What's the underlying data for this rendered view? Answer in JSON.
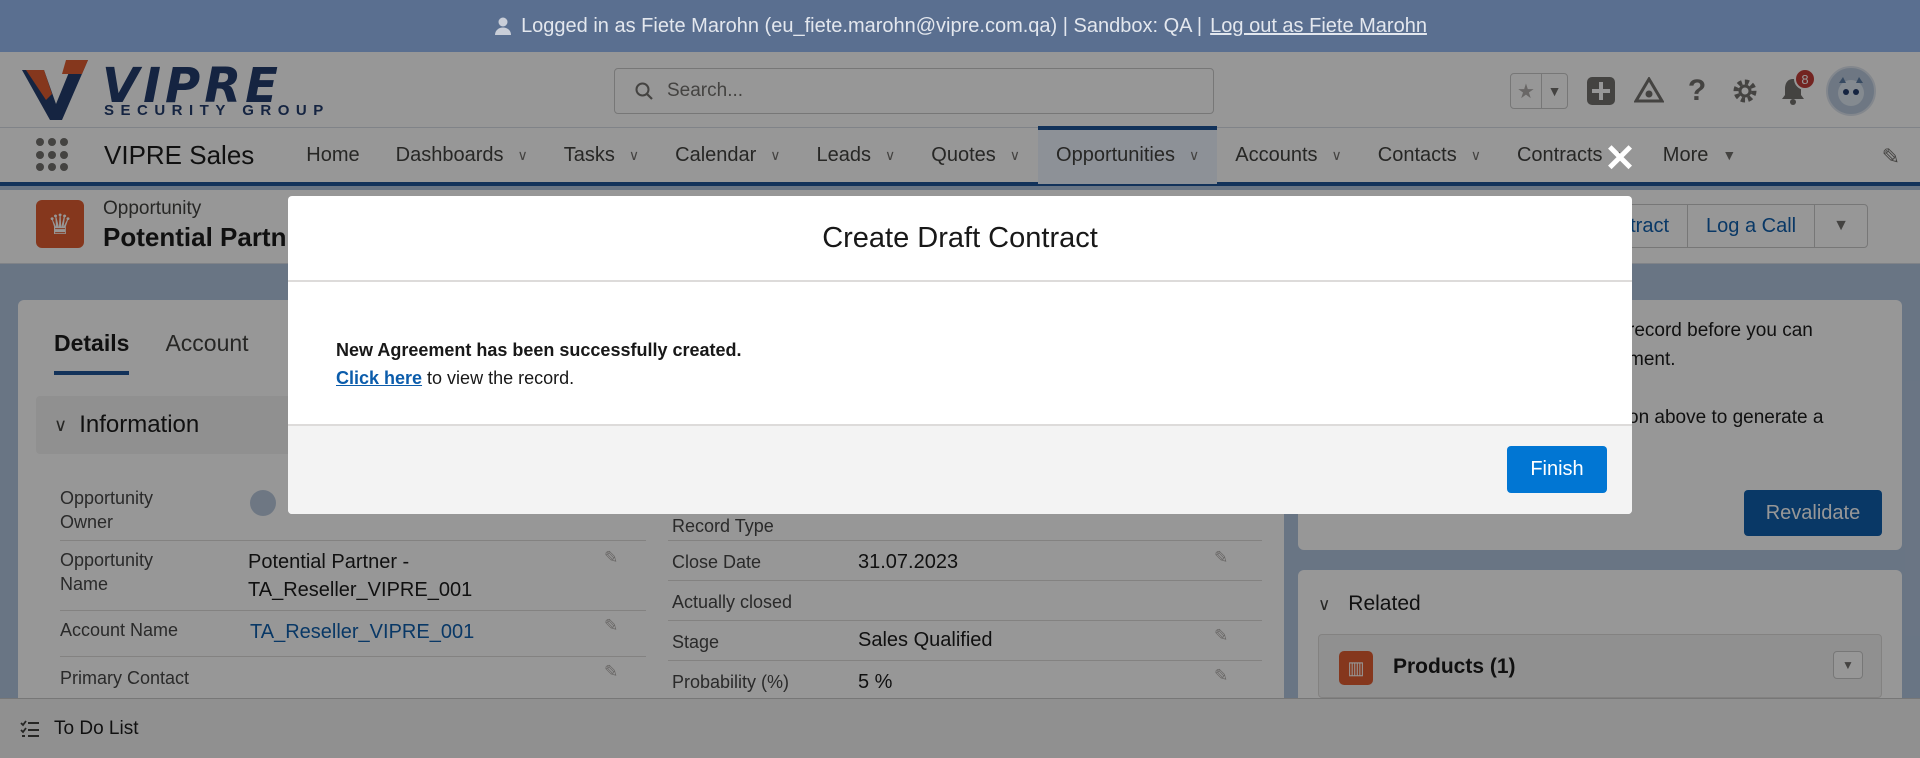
{
  "system_bar": {
    "logged_in_text": "Logged in as Fiete Marohn (eu_fiete.marohn@vipre.com.qa) | Sandbox: QA |",
    "logout_link": "Log out as Fiete Marohn"
  },
  "header": {
    "logo_word": "VIPRE",
    "logo_sub": "SECURITY GROUP",
    "search_placeholder": "Search...",
    "notification_count": "8"
  },
  "nav": {
    "app_name": "VIPRE Sales",
    "items": [
      {
        "label": "Home",
        "has_menu": false
      },
      {
        "label": "Dashboards",
        "has_menu": true
      },
      {
        "label": "Tasks",
        "has_menu": true
      },
      {
        "label": "Calendar",
        "has_menu": true
      },
      {
        "label": "Leads",
        "has_menu": true
      },
      {
        "label": "Quotes",
        "has_menu": true
      },
      {
        "label": "Opportunities",
        "has_menu": true,
        "active": true
      },
      {
        "label": "Accounts",
        "has_menu": true
      },
      {
        "label": "Contacts",
        "has_menu": true
      },
      {
        "label": "Contracts",
        "has_menu": true
      },
      {
        "label": "More",
        "has_menu": true
      }
    ]
  },
  "record_header": {
    "type": "Opportunity",
    "name": "Potential Partn",
    "buttons": [
      "ntract",
      "Log a Call"
    ]
  },
  "detail": {
    "tabs": [
      "Details",
      "Account"
    ],
    "section_title": "Information",
    "left_fields": [
      {
        "label": "Opportunity Owner",
        "value": ""
      },
      {
        "label": "Opportunity Name",
        "value": "Potential Partner - TA_Reseller_VIPRE_001"
      },
      {
        "label": "Account Name",
        "value": "TA_Reseller_VIPRE_001"
      },
      {
        "label": "Primary Contact",
        "value": ""
      }
    ],
    "right_fields": [
      {
        "label": "Record Type",
        "value": ""
      },
      {
        "label": "Close Date",
        "value": "31.07.2023"
      },
      {
        "label": "Actually closed",
        "value": ""
      },
      {
        "label": "Stage",
        "value": "Sales Qualified"
      },
      {
        "label": "Probability (%)",
        "value": "5 %"
      }
    ]
  },
  "side_panel": {
    "text_line1": "record before you can",
    "text_line2": "ment.",
    "text_line3": "on above to generate a",
    "revalidate_label": "Revalidate",
    "related_title": "Related",
    "products_label": "Products (1)"
  },
  "utility_bar": {
    "todo_label": "To Do List"
  },
  "modal": {
    "title": "Create Draft Contract",
    "success_message": "New Agreement has been successfully created.",
    "link_text": "Click here",
    "link_suffix": " to view the record.",
    "finish_label": "Finish",
    "close_glyph": "✕"
  },
  "colors": {
    "brand_blue": "#0176d3",
    "nav_accent": "#1b5297",
    "opportunity_orange": "#e15b2d",
    "notification_red": "#c23934"
  }
}
